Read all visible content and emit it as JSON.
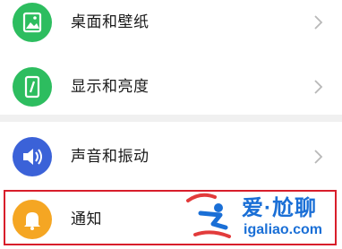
{
  "settings": {
    "items": [
      {
        "label": "桌面和壁纸",
        "icon": "wallpaper-icon",
        "color": "#2dbd5f"
      },
      {
        "label": "显示和亮度",
        "icon": "display-phone-icon",
        "color": "#2dbd5f"
      },
      {
        "label": "声音和振动",
        "icon": "speaker-icon",
        "color": "#3b62d8"
      },
      {
        "label": "通知",
        "icon": "bell-icon",
        "color": "#f5a623"
      }
    ]
  },
  "watermark": {
    "brand": "爱·尬聊",
    "url": "igaliao.com",
    "color": "#1a6fd6"
  },
  "highlight_color": "#d81e2b"
}
